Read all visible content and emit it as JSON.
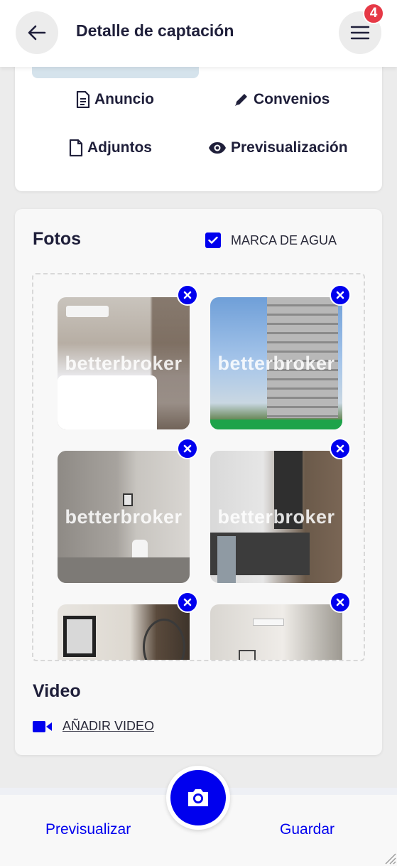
{
  "header": {
    "title": "Detalle de captación",
    "notification_count": "4"
  },
  "actions": {
    "anuncio": "Anuncio",
    "convenios": "Convenios",
    "adjuntos": "Adjuntos",
    "previsualizacion": "Previsualización"
  },
  "photos": {
    "title": "Fotos",
    "watermark_label": "MARCA DE AGUA",
    "watermark_checked": true,
    "watermark_text": "betterbroker",
    "items": [
      {
        "subject": "bedroom"
      },
      {
        "subject": "building"
      },
      {
        "subject": "bathroom"
      },
      {
        "subject": "desk"
      },
      {
        "subject": "living-room"
      },
      {
        "subject": "room"
      }
    ]
  },
  "video": {
    "title": "Video",
    "add_label": "AÑADIR VIDEO"
  },
  "footer": {
    "preview_label": "Previsualizar",
    "save_label": "Guardar"
  },
  "colors": {
    "accent": "#0000ee",
    "badge": "#e63946",
    "text": "#1f1f3a"
  }
}
